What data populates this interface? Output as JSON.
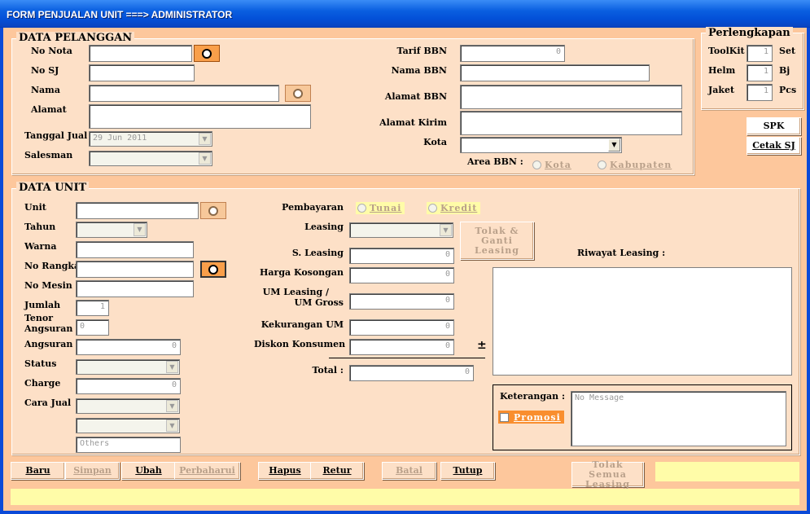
{
  "window": {
    "title": "FORM PENJUALAN UNIT ===> ADMINISTRATOR"
  },
  "pelanggan": {
    "legend": "DATA PELANGGAN",
    "no_nota": "No Nota",
    "no_sj": "No SJ",
    "nama": "Nama",
    "alamat": "Alamat",
    "tanggal_jual": "Tanggal Jual",
    "tanggal_jual_value": "29 Jun  2011",
    "salesman": "Salesman",
    "tarif_bbn": "Tarif BBN",
    "tarif_bbn_value": "0",
    "nama_bbn": "Nama BBN",
    "alamat_bbn": "Alamat BBN",
    "alamat_kirim": "Alamat Kirim",
    "kota": "Kota",
    "area_bbn": "Area BBN :",
    "area_kota": "Kota",
    "area_kabupaten": "Kabupaten"
  },
  "perlengkapan": {
    "legend": "Perlengkapan",
    "toolkit": "ToolKit",
    "toolkit_value": "1",
    "toolkit_unit": "Set",
    "helm": "Helm",
    "helm_value": "1",
    "helm_unit": "Bj",
    "jaket": "Jaket",
    "jaket_value": "1",
    "jaket_unit": "Pcs"
  },
  "side_buttons": {
    "spk": "SPK",
    "cetak_sj": "Cetak SJ"
  },
  "unit": {
    "legend": "DATA UNIT",
    "unit": "Unit",
    "tahun": "Tahun",
    "warna": "Warna",
    "no_rangka": "No Rangka",
    "no_mesin": "No Mesin",
    "jumlah": "Jumlah",
    "jumlah_value": "1",
    "tenor": "Tenor",
    "tenor2": "Angsuran",
    "tenor_value": "0",
    "angsuran": "Angsuran",
    "angsuran_value": "0",
    "status": "Status",
    "charge": "Charge",
    "charge_value": "0",
    "cara_jual": "Cara Jual",
    "others_placeholder": "Others",
    "pembayaran": "Pembayaran",
    "tunai": "Tunai",
    "kredit": "Kredit",
    "leasing": "Leasing",
    "tolak_ganti": "Tolak & Ganti Leasing",
    "s_leasing": "S. Leasing",
    "s_leasing_value": "0",
    "harga_kosongan": "Harga Kosongan",
    "harga_kosongan_value": "0",
    "um_leasing": "UM Leasing /",
    "um_gross": "UM Gross",
    "um_value": "0",
    "kekurangan_um": "Kekurangan UM",
    "kekurangan_um_value": "0",
    "diskon": "Diskon Konsumen",
    "diskon_value": "0",
    "plus_minus": "±",
    "total": "Total :",
    "total_value": "0",
    "riwayat": "Riwayat Leasing :",
    "keterangan": "Keterangan :",
    "keterangan_placeholder": "No Message",
    "promosi": "Promosi"
  },
  "toolbar": {
    "baru": "Baru",
    "simpan": "Simpan",
    "ubah": "Ubah",
    "perbaharui": "Perbaharui",
    "hapus": "Hapus",
    "retur": "Retur",
    "batal": "Batal",
    "tutup": "Tutup",
    "tolak_semua": "Tolak Semua Leasing"
  }
}
